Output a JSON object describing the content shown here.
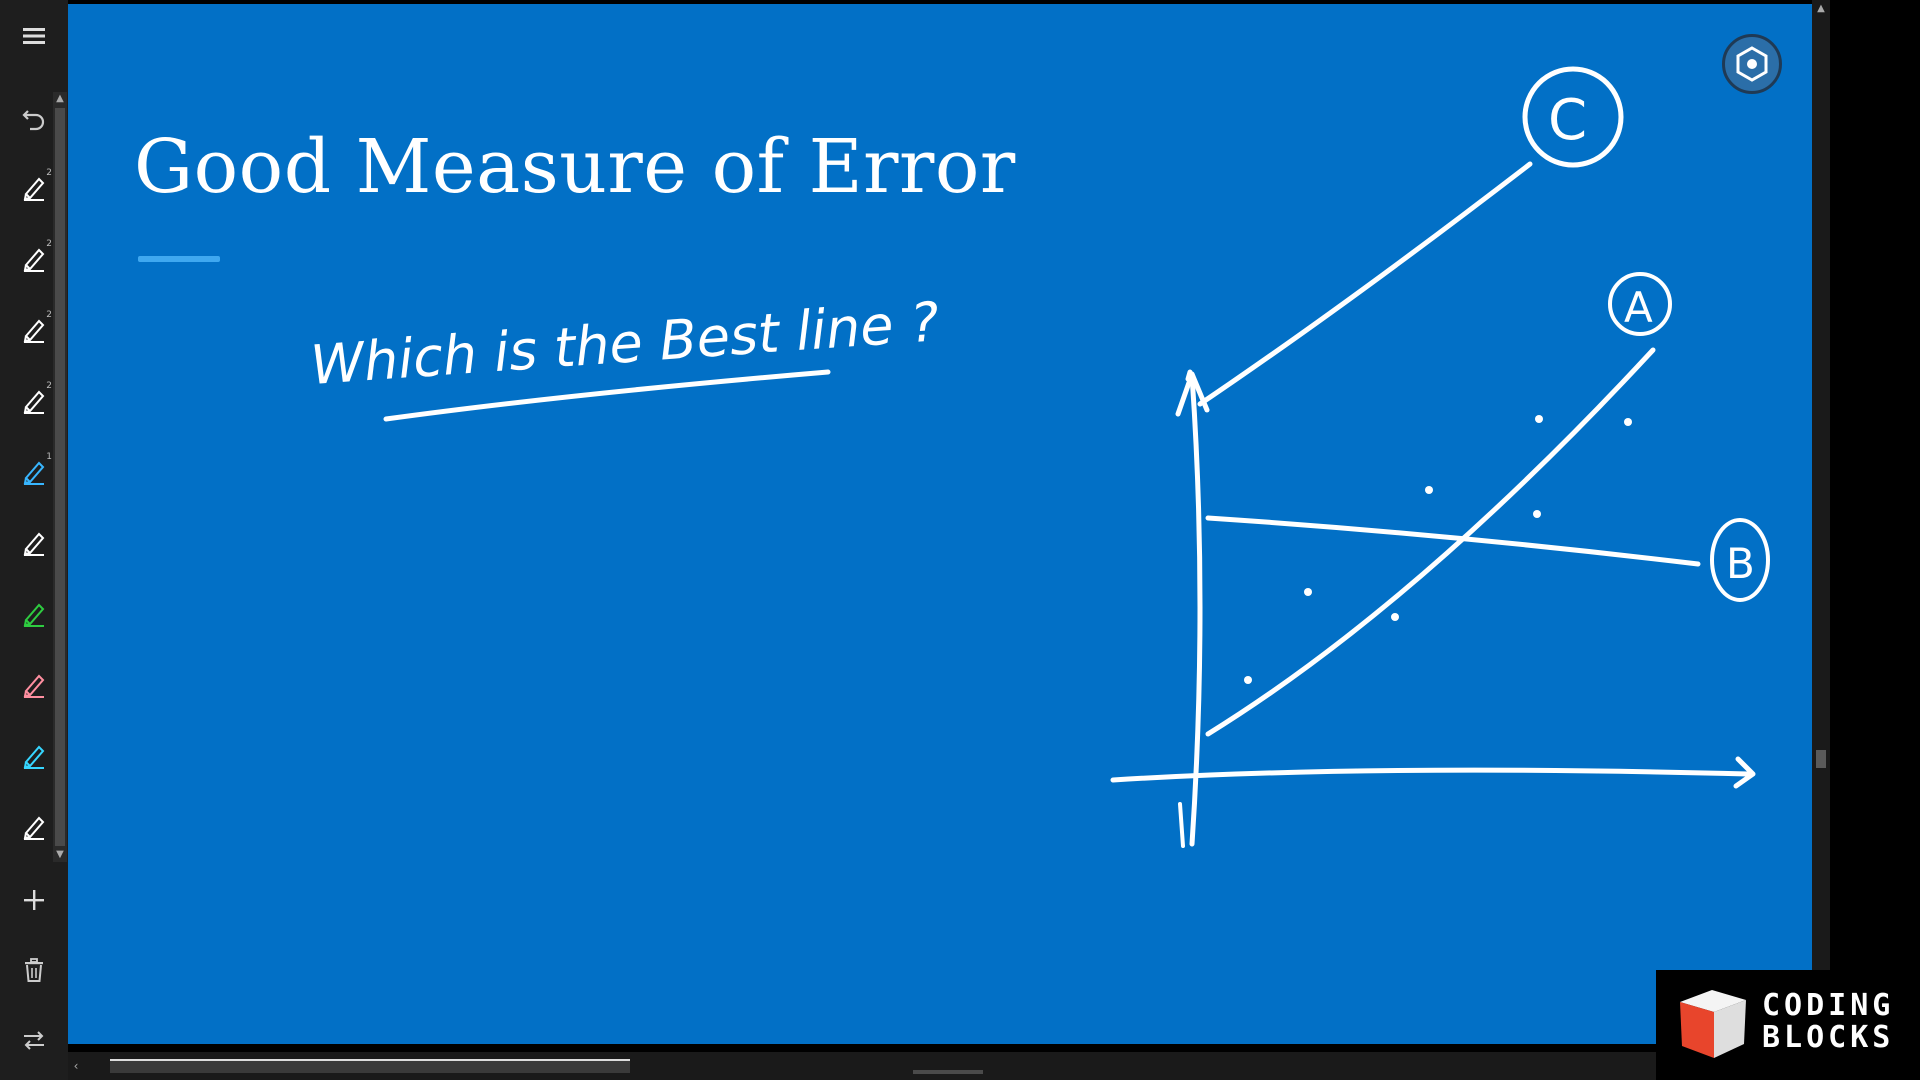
{
  "slide": {
    "title": "Good Measure of Error",
    "handwritten_question": "Which is the Best line ?",
    "line_labels": [
      "C",
      "A",
      "B"
    ]
  },
  "toolbar": {
    "menu_icon": "hamburger-icon",
    "undo_icon": "undo-icon",
    "pens": [
      {
        "name": "pen-1",
        "count": "2",
        "color": "#ffffff"
      },
      {
        "name": "pen-2",
        "count": "2",
        "color": "#ffffff"
      },
      {
        "name": "pen-3",
        "count": "2",
        "color": "#ffffff"
      },
      {
        "name": "pen-4",
        "count": "2",
        "color": "#ffffff"
      },
      {
        "name": "pen-5",
        "count": "1",
        "color": "#38b6ff"
      },
      {
        "name": "pen-6",
        "count": "",
        "color": "#ffffff"
      },
      {
        "name": "pen-7",
        "count": "",
        "color": "#2ecc40"
      },
      {
        "name": "pen-8",
        "count": "",
        "color": "#ff8fa0"
      },
      {
        "name": "pen-9",
        "count": "",
        "color": "#36d6ff"
      },
      {
        "name": "pen-10",
        "count": "",
        "color": "#ffffff"
      }
    ],
    "add_icon": "plus-icon",
    "delete_icon": "trash-icon",
    "swap_icon": "swap-arrows-icon"
  },
  "logo": {
    "line1": "CODING",
    "line2": "BLOCKS"
  },
  "colors": {
    "canvas": "#0270c6",
    "toolbar": "#1e1e1e",
    "ink": "#ffffff",
    "accent": "#3fa8f0"
  }
}
